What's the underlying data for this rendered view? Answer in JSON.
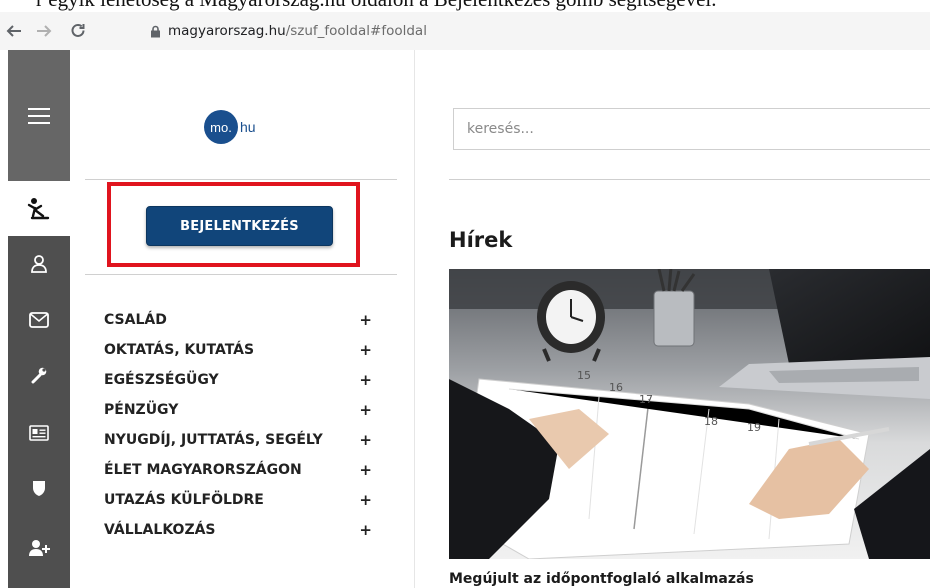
{
  "top_text": "r egyik lehetőség a Magyarország.hu oldalon a Bejelentkezés gomb segítségével.",
  "browser": {
    "url_host": "magyarorszag.hu",
    "url_path": "/szuf_fooldal#fooldal"
  },
  "icons": {
    "back": "arrow-left-icon",
    "forward": "arrow-right-icon",
    "reload": "reload-icon",
    "lock": "lock-icon",
    "menu": "hamburger-menu-icon",
    "accessibility": "accessibility-icon",
    "user": "user-icon",
    "mail": "mail-icon",
    "wrench": "wrench-icon",
    "card": "id-card-icon",
    "shield": "shield-icon",
    "add_user": "add-user-icon"
  },
  "logo": {
    "circle_text": "mo.",
    "suffix": "hu"
  },
  "login_button": "BEJELENTKEZÉS",
  "menu": [
    {
      "label": "CSALÁD",
      "toggle": "+"
    },
    {
      "label": "OKTATÁS, KUTATÁS",
      "toggle": "+"
    },
    {
      "label": "EGÉSZSÉGÜGY",
      "toggle": "+"
    },
    {
      "label": "PÉNZÜGY",
      "toggle": "+"
    },
    {
      "label": "NYUGDÍJ, JUTTATÁS, SEGÉLY",
      "toggle": "+"
    },
    {
      "label": "ÉLET MAGYARORSZÁGON",
      "toggle": "+"
    },
    {
      "label": "UTAZÁS KÜLFÖLDRE",
      "toggle": "+"
    },
    {
      "label": "VÁLLALKOZÁS",
      "toggle": "+"
    }
  ],
  "search": {
    "placeholder": "keresés..."
  },
  "news": {
    "section_title": "Hírek",
    "image_alt": "Planner with dates 15, 16, 17, 18, 19 and a clock on a desk",
    "planner_dates": [
      "15",
      "16",
      "17",
      "18",
      "19"
    ],
    "item_title": "Megújult az időpontfoglaló alkalmazás"
  },
  "colors": {
    "brand_blue": "#11457a",
    "highlight_red": "#e0141e",
    "iconbar": "#4f4f4f"
  }
}
